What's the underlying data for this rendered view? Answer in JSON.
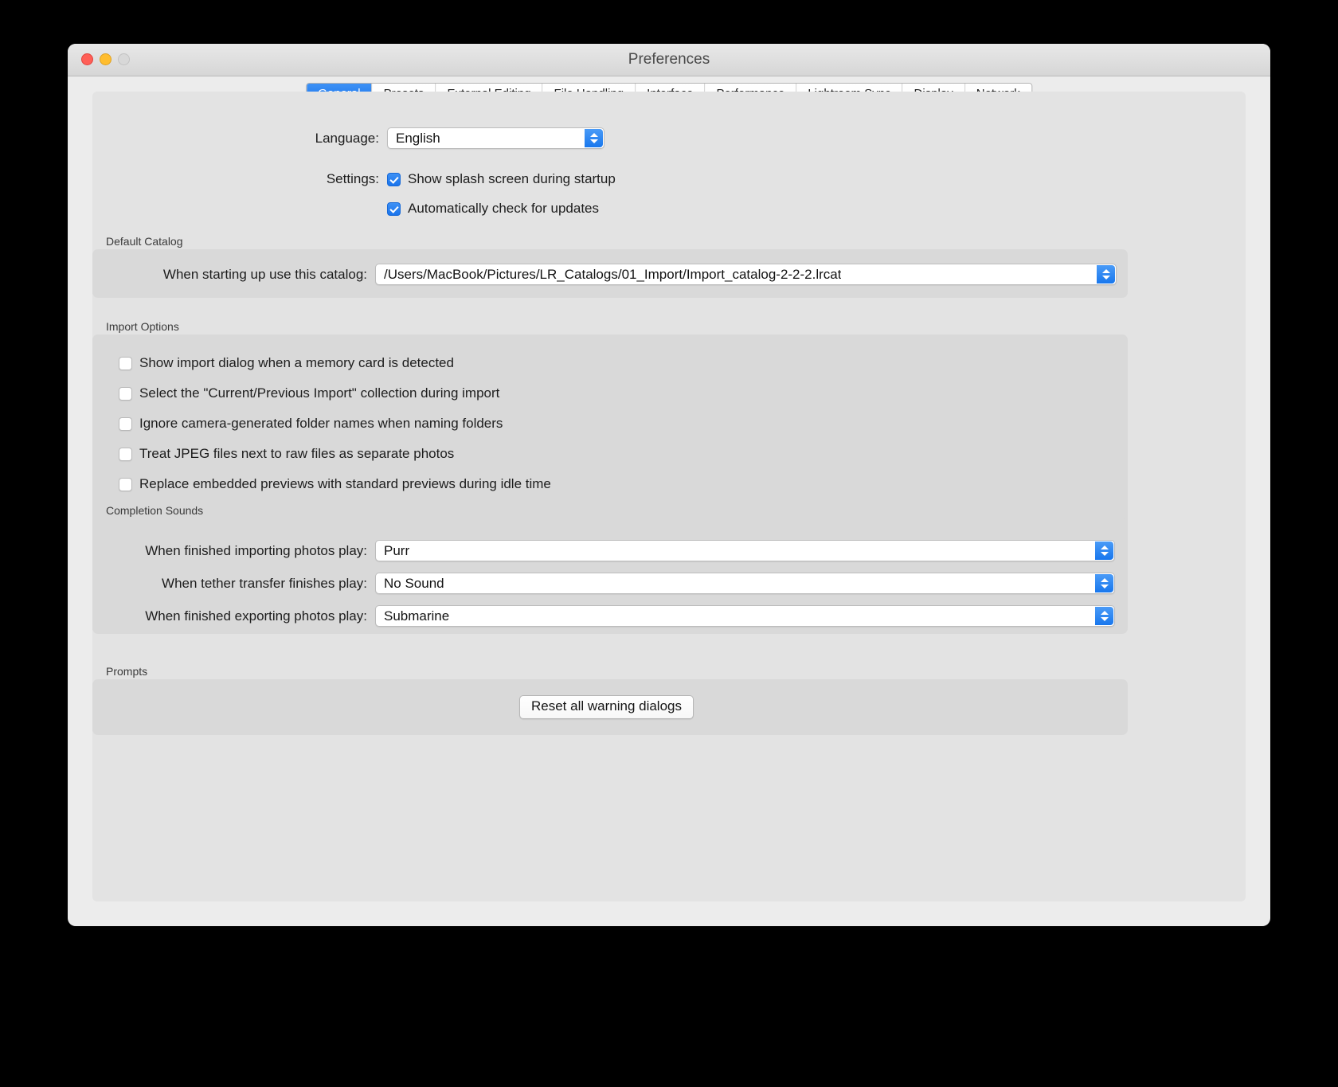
{
  "window": {
    "title": "Preferences",
    "traffic_lights": [
      "close-button",
      "minimize-button",
      "zoom-button"
    ]
  },
  "tabs": [
    {
      "label": "General",
      "active": true
    },
    {
      "label": "Presets",
      "active": false
    },
    {
      "label": "External Editing",
      "active": false
    },
    {
      "label": "File Handling",
      "active": false
    },
    {
      "label": "Interface",
      "active": false
    },
    {
      "label": "Performance",
      "active": false
    },
    {
      "label": "Lightroom Sync",
      "active": false
    },
    {
      "label": "Display",
      "active": false
    },
    {
      "label": "Network",
      "active": false
    }
  ],
  "language": {
    "label": "Language:",
    "value": "English"
  },
  "settings": {
    "label": "Settings:",
    "options": [
      {
        "label": "Show splash screen during startup",
        "checked": true
      },
      {
        "label": "Automatically check for updates",
        "checked": true
      }
    ]
  },
  "default_catalog": {
    "title": "Default Catalog",
    "label": "When starting up use this catalog:",
    "value": "/Users/MacBook/Pictures/LR_Catalogs/01_Import/Import_catalog-2-2-2.lrcat"
  },
  "import_options": {
    "title": "Import Options",
    "options": [
      {
        "label": "Show import dialog when a memory card is detected",
        "checked": false
      },
      {
        "label": "Select the \"Current/Previous Import\" collection during import",
        "checked": false
      },
      {
        "label": "Ignore camera-generated folder names when naming folders",
        "checked": false
      },
      {
        "label": "Treat JPEG files next to raw files as separate photos",
        "checked": false
      },
      {
        "label": "Replace embedded previews with standard previews during idle time",
        "checked": false
      }
    ]
  },
  "completion_sounds": {
    "title": "Completion Sounds",
    "rows": [
      {
        "label": "When finished importing photos play:",
        "value": "Purr"
      },
      {
        "label": "When tether transfer finishes play:",
        "value": "No Sound"
      },
      {
        "label": "When finished exporting photos play:",
        "value": "Submarine"
      }
    ]
  },
  "prompts": {
    "title": "Prompts",
    "reset_button": "Reset all warning dialogs"
  },
  "colors": {
    "accent_blue": "#1a74ec",
    "window_bg": "#ececec",
    "panel_bg": "#e3e3e3",
    "group_bg": "#d9d9d9"
  }
}
